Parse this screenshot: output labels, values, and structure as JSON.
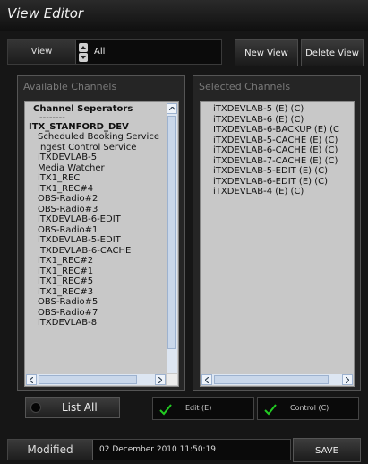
{
  "window": {
    "title": "View Editor"
  },
  "toolbar": {
    "view_label": "View",
    "view_value": "All",
    "new_view_label": "New View",
    "delete_view_label": "Delete View"
  },
  "available": {
    "title": "Available Channels",
    "items": [
      "Channel Seperators",
      "--------",
      "ITX_STANFORD_DEV",
      "Scheduled Booking Service",
      "Ingest Control Service",
      "iTXDEVLAB-5",
      "Media Watcher",
      "iTX1_REC",
      "iTX1_REC#4",
      "OBS-Radio#2",
      "OBS-Radio#3",
      "iTXDEVLAB-6-EDIT",
      "OBS-Radio#1",
      "iTXDEVLAB-5-EDIT",
      "ITXDEVLAB-6-CACHE",
      "iTX1_REC#2",
      "iTX1_REC#1",
      "iTX1_REC#5",
      "iTX1_REC#3",
      "OBS-Radio#5",
      "OBS-Radio#7",
      "iTXDEVLAB-8"
    ]
  },
  "selected": {
    "title": "Selected Channels",
    "items": [
      "iTXDEVLAB-5 (E) (C)",
      "iTXDEVLAB-6 (E) (C)",
      "ITXDEVLAB-6-BACKUP (E) (C",
      "iTXDEVLAB-5-CACHE (E) (C)",
      "iTXDEVLAB-6-CACHE (E) (C)",
      "iTXDEVLAB-7-CACHE (E) (C)",
      "iTXDEVLAB-5-EDIT (E) (C)",
      "iTXDEVLAB-6-EDIT (E) (C)",
      "iTXDEVLAB-4 (E) (C)"
    ]
  },
  "controls": {
    "list_all_label": "List All",
    "edit_label": "Edit (E)",
    "control_label": "Control (C)"
  },
  "status": {
    "modified_label": "Modified",
    "timestamp": "02 December 2010 11:50:19",
    "save_label": "SAVE"
  },
  "colors": {
    "background": "#161616",
    "list_background": "#c8c8c8",
    "scrollbar": "#dde6f2",
    "check_green": "#22cc22"
  }
}
